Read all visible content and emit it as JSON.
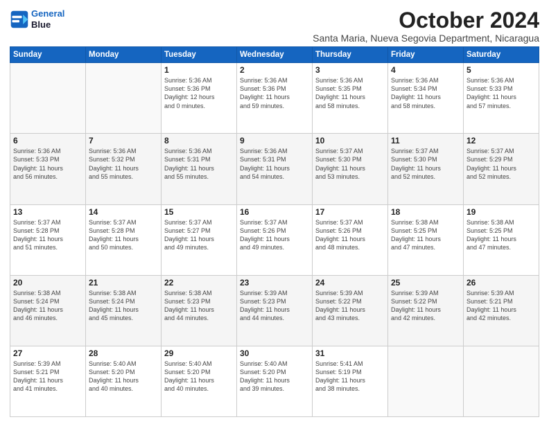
{
  "header": {
    "logo_line1": "General",
    "logo_line2": "Blue",
    "month": "October 2024",
    "location": "Santa Maria, Nueva Segovia Department, Nicaragua"
  },
  "weekdays": [
    "Sunday",
    "Monday",
    "Tuesday",
    "Wednesday",
    "Thursday",
    "Friday",
    "Saturday"
  ],
  "weeks": [
    [
      {
        "day": "",
        "info": ""
      },
      {
        "day": "",
        "info": ""
      },
      {
        "day": "1",
        "info": "Sunrise: 5:36 AM\nSunset: 5:36 PM\nDaylight: 12 hours\nand 0 minutes."
      },
      {
        "day": "2",
        "info": "Sunrise: 5:36 AM\nSunset: 5:36 PM\nDaylight: 11 hours\nand 59 minutes."
      },
      {
        "day": "3",
        "info": "Sunrise: 5:36 AM\nSunset: 5:35 PM\nDaylight: 11 hours\nand 58 minutes."
      },
      {
        "day": "4",
        "info": "Sunrise: 5:36 AM\nSunset: 5:34 PM\nDaylight: 11 hours\nand 58 minutes."
      },
      {
        "day": "5",
        "info": "Sunrise: 5:36 AM\nSunset: 5:33 PM\nDaylight: 11 hours\nand 57 minutes."
      }
    ],
    [
      {
        "day": "6",
        "info": "Sunrise: 5:36 AM\nSunset: 5:33 PM\nDaylight: 11 hours\nand 56 minutes."
      },
      {
        "day": "7",
        "info": "Sunrise: 5:36 AM\nSunset: 5:32 PM\nDaylight: 11 hours\nand 55 minutes."
      },
      {
        "day": "8",
        "info": "Sunrise: 5:36 AM\nSunset: 5:31 PM\nDaylight: 11 hours\nand 55 minutes."
      },
      {
        "day": "9",
        "info": "Sunrise: 5:36 AM\nSunset: 5:31 PM\nDaylight: 11 hours\nand 54 minutes."
      },
      {
        "day": "10",
        "info": "Sunrise: 5:37 AM\nSunset: 5:30 PM\nDaylight: 11 hours\nand 53 minutes."
      },
      {
        "day": "11",
        "info": "Sunrise: 5:37 AM\nSunset: 5:30 PM\nDaylight: 11 hours\nand 52 minutes."
      },
      {
        "day": "12",
        "info": "Sunrise: 5:37 AM\nSunset: 5:29 PM\nDaylight: 11 hours\nand 52 minutes."
      }
    ],
    [
      {
        "day": "13",
        "info": "Sunrise: 5:37 AM\nSunset: 5:28 PM\nDaylight: 11 hours\nand 51 minutes."
      },
      {
        "day": "14",
        "info": "Sunrise: 5:37 AM\nSunset: 5:28 PM\nDaylight: 11 hours\nand 50 minutes."
      },
      {
        "day": "15",
        "info": "Sunrise: 5:37 AM\nSunset: 5:27 PM\nDaylight: 11 hours\nand 49 minutes."
      },
      {
        "day": "16",
        "info": "Sunrise: 5:37 AM\nSunset: 5:26 PM\nDaylight: 11 hours\nand 49 minutes."
      },
      {
        "day": "17",
        "info": "Sunrise: 5:37 AM\nSunset: 5:26 PM\nDaylight: 11 hours\nand 48 minutes."
      },
      {
        "day": "18",
        "info": "Sunrise: 5:38 AM\nSunset: 5:25 PM\nDaylight: 11 hours\nand 47 minutes."
      },
      {
        "day": "19",
        "info": "Sunrise: 5:38 AM\nSunset: 5:25 PM\nDaylight: 11 hours\nand 47 minutes."
      }
    ],
    [
      {
        "day": "20",
        "info": "Sunrise: 5:38 AM\nSunset: 5:24 PM\nDaylight: 11 hours\nand 46 minutes."
      },
      {
        "day": "21",
        "info": "Sunrise: 5:38 AM\nSunset: 5:24 PM\nDaylight: 11 hours\nand 45 minutes."
      },
      {
        "day": "22",
        "info": "Sunrise: 5:38 AM\nSunset: 5:23 PM\nDaylight: 11 hours\nand 44 minutes."
      },
      {
        "day": "23",
        "info": "Sunrise: 5:39 AM\nSunset: 5:23 PM\nDaylight: 11 hours\nand 44 minutes."
      },
      {
        "day": "24",
        "info": "Sunrise: 5:39 AM\nSunset: 5:22 PM\nDaylight: 11 hours\nand 43 minutes."
      },
      {
        "day": "25",
        "info": "Sunrise: 5:39 AM\nSunset: 5:22 PM\nDaylight: 11 hours\nand 42 minutes."
      },
      {
        "day": "26",
        "info": "Sunrise: 5:39 AM\nSunset: 5:21 PM\nDaylight: 11 hours\nand 42 minutes."
      }
    ],
    [
      {
        "day": "27",
        "info": "Sunrise: 5:39 AM\nSunset: 5:21 PM\nDaylight: 11 hours\nand 41 minutes."
      },
      {
        "day": "28",
        "info": "Sunrise: 5:40 AM\nSunset: 5:20 PM\nDaylight: 11 hours\nand 40 minutes."
      },
      {
        "day": "29",
        "info": "Sunrise: 5:40 AM\nSunset: 5:20 PM\nDaylight: 11 hours\nand 40 minutes."
      },
      {
        "day": "30",
        "info": "Sunrise: 5:40 AM\nSunset: 5:20 PM\nDaylight: 11 hours\nand 39 minutes."
      },
      {
        "day": "31",
        "info": "Sunrise: 5:41 AM\nSunset: 5:19 PM\nDaylight: 11 hours\nand 38 minutes."
      },
      {
        "day": "",
        "info": ""
      },
      {
        "day": "",
        "info": ""
      }
    ]
  ]
}
